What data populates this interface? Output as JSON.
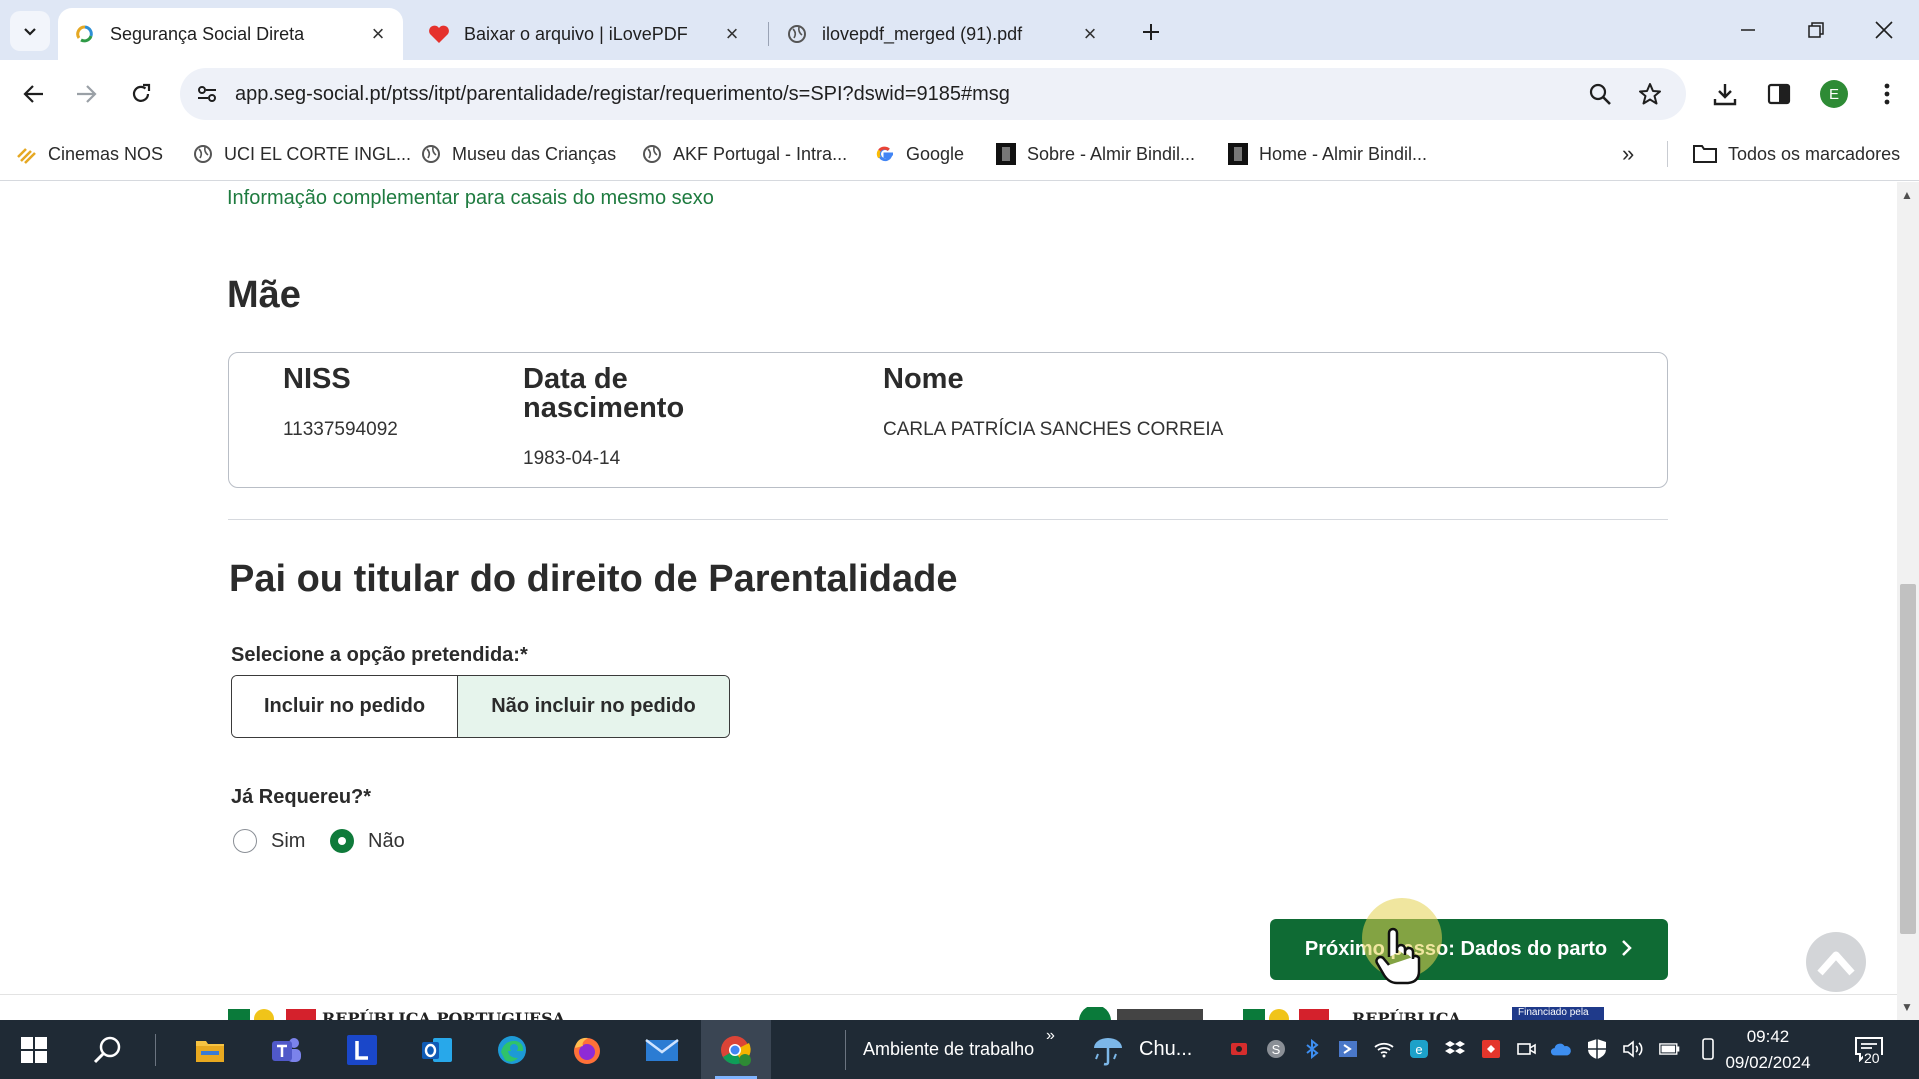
{
  "browser": {
    "tabs": [
      {
        "label": "Segurança Social Direta",
        "active": true
      },
      {
        "label": "Baixar o arquivo | iLovePDF",
        "active": false
      },
      {
        "label": "ilovepdf_merged (91).pdf",
        "active": false
      }
    ],
    "url": "app.seg-social.pt/ptss/itpt/parentalidade/registar/requerimento/s=SPI?dswid=9185#msg",
    "profile_initial": "E",
    "bookmarks": [
      {
        "label": "Cinemas NOS",
        "icon": "cinemas-nos-icon"
      },
      {
        "label": "UCI EL CORTE INGL...",
        "icon": "globe-icon"
      },
      {
        "label": "Museu das Crianças",
        "icon": "globe-icon"
      },
      {
        "label": "AKF Portugal - Intra...",
        "icon": "globe-icon"
      },
      {
        "label": "Google",
        "icon": "google-icon"
      },
      {
        "label": "Sobre - Almir Bindil...",
        "icon": "site-icon"
      },
      {
        "label": "Home - Almir Bindil...",
        "icon": "site-icon"
      }
    ],
    "all_bookmarks_label": "Todos os marcadores"
  },
  "page": {
    "complement_link": "Informação complementar para casais do mesmo sexo",
    "mother_heading": "Mãe",
    "mother": {
      "niss_header": "NISS",
      "niss_value": "11337594092",
      "birth_header": "Data de nascimento",
      "birth_value": "1983-04-14",
      "name_header": "Nome",
      "name_value": "CARLA PATRÍCIA SANCHES CORREIA"
    },
    "father_heading": "Pai ou titular do direito de Parentalidade",
    "option_label": "Selecione a opção pretendida:*",
    "options": [
      "Incluir no pedido",
      "Não incluir no pedido"
    ],
    "selected_option": "Não incluir no pedido",
    "already_label": "Já Requereu?*",
    "radio_yes": "Sim",
    "radio_no": "Não",
    "radio_selected": "Não",
    "next_button": "Próximo passo: Dados do parto",
    "footer_left": "REPÚBLICA PORTUGUESA",
    "footer_right": "REPÚBLICA",
    "footer_funded": "Financiado pela"
  },
  "taskbar": {
    "desktop_label": "Ambiente de trabalho",
    "weather_label": "Chu...",
    "time": "09:42",
    "date": "09/02/2024",
    "notification_count": "20",
    "colors": {
      "accent_green": "#0f6b34",
      "link_green": "#1e7b3f",
      "selected_bg": "#e6f4ec"
    }
  }
}
